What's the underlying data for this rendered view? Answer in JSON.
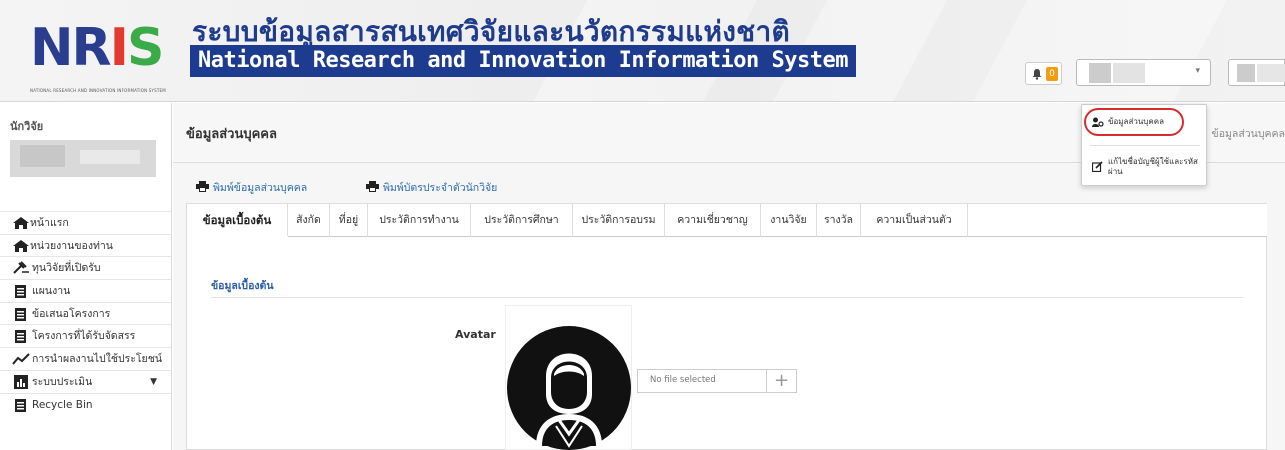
{
  "header": {
    "logo_text": "NRIS",
    "logo_tagline": "NATIONAL RESEARCH AND INNOVATION INFORMATION SYSTEM",
    "title_th": "ระบบข้อมูลสารสนเทศวิจัยและนวัตกรรมแห่งชาติ",
    "title_en": "National Research and Innovation Information System",
    "notification_count": "0"
  },
  "user_menu": {
    "items": [
      {
        "label": "ข้อมูลส่วนบุคคล",
        "icon": "user-key-icon"
      },
      {
        "label": "แก้ไขชื่อบัญชีผู้ใช้และรหัสผ่าน",
        "icon": "edit-icon"
      }
    ]
  },
  "sidebar": {
    "role": "นักวิจัย",
    "items": [
      {
        "label": "หน้าแรก",
        "icon": "home-icon"
      },
      {
        "label": "หน่วยงานของท่าน",
        "icon": "home-icon"
      },
      {
        "label": "ทุนวิจัยที่เปิดรับ",
        "icon": "gavel-icon"
      },
      {
        "label": "แผนงาน",
        "icon": "clipboard-icon"
      },
      {
        "label": "ข้อเสนอโครงการ",
        "icon": "clipboard-icon"
      },
      {
        "label": "โครงการที่ได้รับจัดสรร",
        "icon": "clipboard-icon"
      },
      {
        "label": "การนำผลงานไปใช้ประโยชน์",
        "icon": "line-chart-icon"
      },
      {
        "label": "ระบบประเมิน",
        "icon": "bar-chart-icon",
        "has_dropdown": true
      },
      {
        "label": "Recycle Bin",
        "icon": "clipboard-icon"
      }
    ]
  },
  "main": {
    "page_title": "ข้อมูลส่วนบุคคล",
    "breadcrumb": "ข้อมูลส่วนบุคคล",
    "actions": [
      {
        "label": "พิมพ์ข้อมูลส่วนบุคคล",
        "icon": "printer-icon"
      },
      {
        "label": "พิมพ์บัตรประจำตัวนักวิจัย",
        "icon": "printer-icon"
      }
    ],
    "tabs": [
      {
        "label": "ข้อมูลเบื้องต้น",
        "active": true
      },
      {
        "label": "สังกัด"
      },
      {
        "label": "ที่อยู่"
      },
      {
        "label": "ประวัติการทำงาน"
      },
      {
        "label": "ประวัติการศึกษา"
      },
      {
        "label": "ประวัติการอบรม"
      },
      {
        "label": "ความเชี่ยวชาญ"
      },
      {
        "label": "งานวิจัย"
      },
      {
        "label": "รางวัล"
      },
      {
        "label": "ความเป็นส่วนตัว"
      }
    ],
    "section_title": "ข้อมูลเบื้องต้น",
    "avatar_label": "Avatar",
    "file_input_placeholder": "No file selected"
  },
  "colors": {
    "brand_blue": "#1d3c8f",
    "link_blue": "#2b6cb0",
    "highlight_red": "#d62c2c",
    "badge_orange": "#f39c12"
  }
}
